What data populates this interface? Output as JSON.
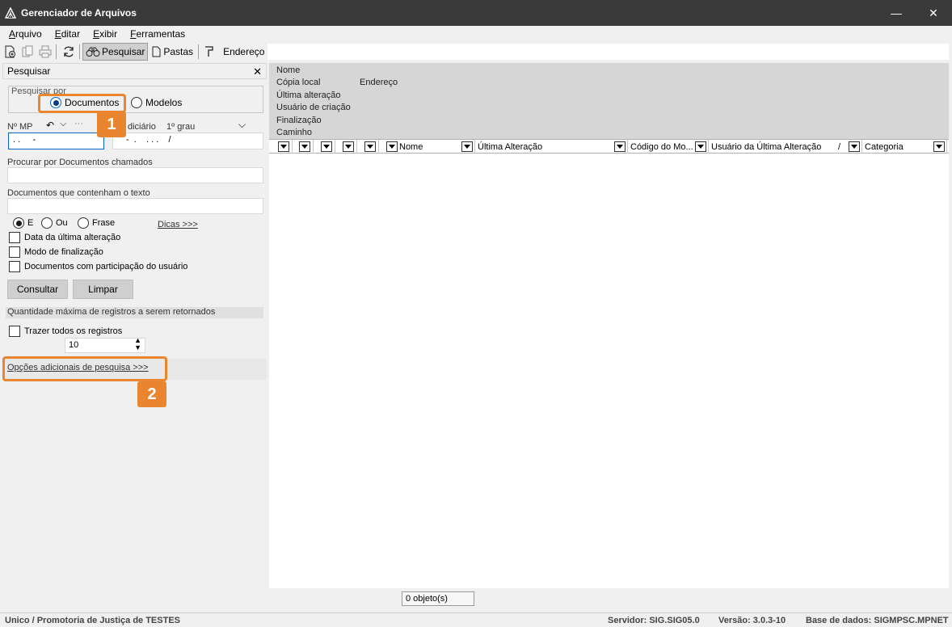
{
  "window": {
    "title": "Gerenciador de Arquivos",
    "minimize": "—",
    "close": "✕"
  },
  "menu": [
    "Arquivo",
    "Editar",
    "Exibir",
    "Ferramentas"
  ],
  "toolbar": {
    "search_label": "Pesquisar",
    "folders_label": "Pastas",
    "address_label": "Endereço",
    "address_value": ""
  },
  "left_pane": {
    "title": "Pesquisar",
    "search_by_label": "Pesquisar por",
    "radio_documentos": "Documentos",
    "radio_modelos": "Modelos",
    "mp_label": "Nº MP",
    "mp_value": ". .     -",
    "judicial_label": "diciário",
    "grau_value": "1º grau",
    "judicial_value": "-  .    . . .    /",
    "nav_ellipsis": "···",
    "procurar_label": "Procurar por Documentos chamados",
    "procurar_value": "",
    "texto_label": "Documentos que contenham o texto",
    "texto_value": "",
    "radio_e": "E",
    "radio_ou": "Ou",
    "radio_frase": "Frase",
    "dicas_link": "Dicas >>>",
    "chk_data": "Data da última alteração",
    "chk_modo": "Modo de finalização",
    "chk_participacao": "Documentos com participação do usuário",
    "btn_consultar": "Consultar",
    "btn_limpar": "Limpar",
    "quantidade_label": "Quantidade máxima de registros a serem retornados",
    "chk_trazer": "Trazer todos os registros",
    "quantidade_value": "10",
    "opcoes_link": "Opções adicionais de pesquisa >>>"
  },
  "badges": [
    "1",
    "2"
  ],
  "info_area": {
    "nome": "Nome",
    "copia": "Cópia local",
    "endereco": "Endereço",
    "ultima": "Última alteração",
    "usuario": "Usuário de criação",
    "finalizacao": "Finalização",
    "caminho": "Caminho"
  },
  "grid": {
    "columns": [
      "Nome",
      "Última Alteração",
      "Código do Mo...",
      "Usuário da Última Alteração",
      "Categoria"
    ],
    "sort_mark": "/",
    "object_count": "0 objeto(s)"
  },
  "status": {
    "unit": "Unico / Promotoria de Justiça de TESTES",
    "server": "Servidor: SIG.SIG05.0",
    "version": "Versão: 3.0.3-10",
    "db": "Base de dados: SIGMPSC.MPNET"
  },
  "colors": {
    "accent": "#e8852e",
    "titlebar": "#3a3a3a"
  }
}
